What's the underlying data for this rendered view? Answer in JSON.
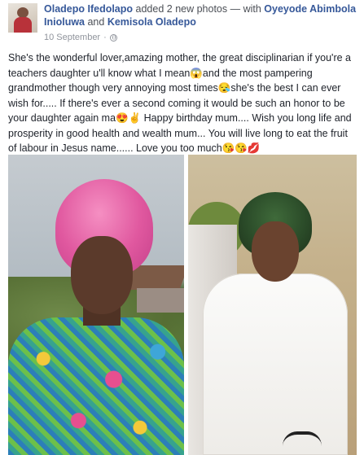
{
  "post": {
    "author": "Oladepo Ifedolapo",
    "action": "added 2 new photos",
    "with_text": "— with",
    "tagged_1": "Oyeyode Abimbola Inioluwa",
    "and_text": "and",
    "tagged_2": "Kemisola Oladepo",
    "date": "10 September",
    "separator": "·",
    "message": "She's the wonderful lover,amazing mother, the great disciplinarian if you're a teachers daughter u'll know what I mean😱and the most pampering grandmother though very annoying most times😪she's the best I can ever wish for..... If there's ever a second coming it would be such an honor to be your daughter again ma😍✌ Happy birthday mum.... Wish you long life and prosperity in good health and wealth mum... You will live long to eat the fruit of labour in Jesus name...... Love you too much😘😘💋"
  },
  "icons": {
    "avatar": "profile-photo",
    "privacy": "globe-icon"
  },
  "colors": {
    "link": "#365899",
    "meta": "#90949c",
    "text": "#1d2129"
  }
}
